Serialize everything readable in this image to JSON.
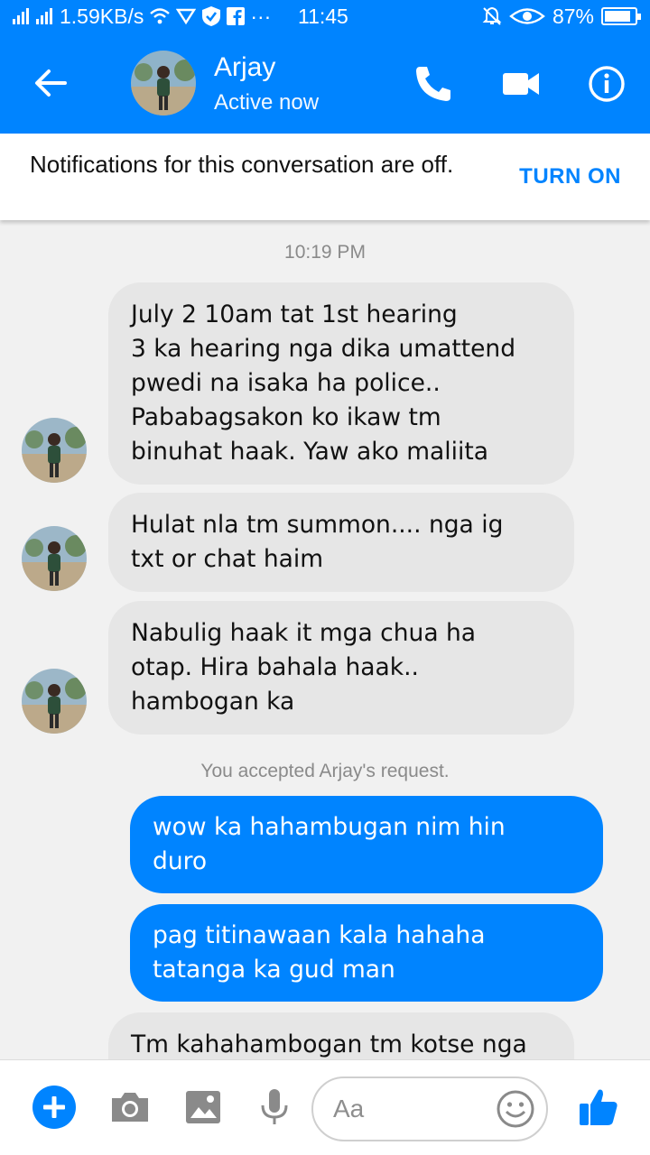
{
  "status_bar": {
    "speed": "1.59KB/s",
    "time": "11:45",
    "more": "···",
    "battery": "87%",
    "battery_level": 0.87
  },
  "header": {
    "contact_name": "Arjay",
    "status": "Active now",
    "icons": [
      "back-arrow-icon",
      "phone-icon",
      "video-camera-icon",
      "info-icon"
    ]
  },
  "notification": {
    "text": "Notifications for this conversation are off.",
    "action": "TURN ON"
  },
  "conversation": {
    "timestamp": "10:19 PM",
    "incoming_1": [
      "July 2 10am tat 1st hearing",
      "3 ka hearing nga dika umattend",
      "pwedi na isaka ha police..",
      "Pababagsakon ko ikaw tm",
      "binuhat haak. Yaw ako maliita"
    ],
    "incoming_2": [
      "Hulat nla tm summon.... nga ig",
      "txt or chat haim"
    ],
    "incoming_3": [
      "Nabulig haak it mga chua ha",
      "otap. Hira bahala haak..",
      "hambogan ka"
    ],
    "system_notice": "You accepted Arjay's request.",
    "outgoing_1": [
      "wow ka hahambugan nim hin",
      "duro"
    ],
    "outgoing_2": [
      "pag titinawaan kala hahaha",
      "tatanga ka gud man"
    ],
    "incoming_4": [
      "Tm kahahambogan tm kotse nga"
    ]
  },
  "composer": {
    "placeholder": "Aa",
    "icons": [
      "plus-icon",
      "camera-icon",
      "image-icon",
      "microphone-icon",
      "emoji-icon",
      "thumbs-up-icon"
    ]
  },
  "colors": {
    "brand": "#0084ff",
    "incoming_bubble": "#e6e6e6",
    "background": "#f1f1f1"
  }
}
